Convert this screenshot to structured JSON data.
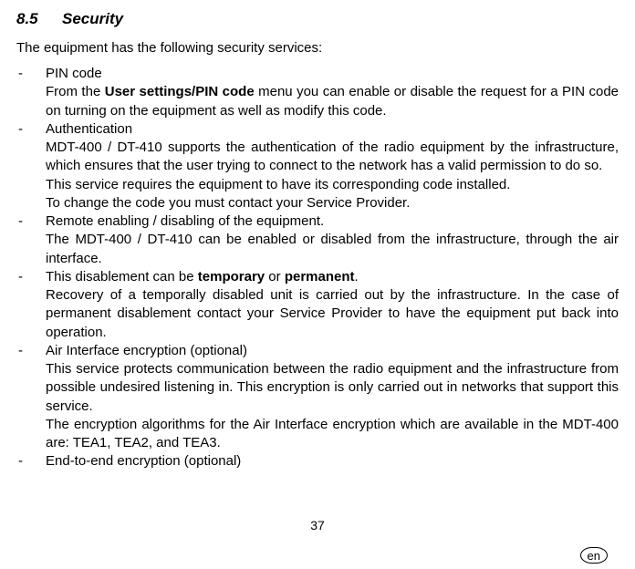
{
  "heading": {
    "number": "8.5",
    "title": "Security"
  },
  "intro": "The equipment has the following security services:",
  "items": [
    {
      "bullet": "PIN code",
      "paras": [
        {
          "pre": "From the ",
          "bold": "User settings/PIN code",
          "post": " menu you can enable or disable the request for a PIN code on turning on the equipment as well as modify this code."
        }
      ]
    },
    {
      "bullet": "Authentication",
      "paras": [
        {
          "pre": "MDT-400 / DT-410 supports the authentication of the radio equipment by the infrastructure, which ensures that the user trying to connect to the network has a valid permission to do so.",
          "bold": "",
          "post": ""
        },
        {
          "pre": "This service requires the equipment to have its corresponding code installed.",
          "bold": "",
          "post": ""
        },
        {
          "pre": "To change the code you must contact your Service Provider.",
          "bold": "",
          "post": ""
        }
      ]
    },
    {
      "bullet": "Remote enabling / disabling of the equipment.",
      "paras": [
        {
          "pre": "The MDT-400 / DT-410 can be enabled or disabled from the infrastructure, through the air interface.",
          "bold": "",
          "post": ""
        }
      ]
    },
    {
      "bullet_pre": "This disablement can be ",
      "bullet_b1": "temporary",
      "bullet_mid": " or ",
      "bullet_b2": "permanent",
      "bullet_post": ".",
      "paras": [
        {
          "pre": "Recovery of a temporally disabled unit is carried out by the infrastructure. In the case of permanent disablement contact your Service Provider to have the equipment put back into operation.",
          "bold": "",
          "post": ""
        }
      ]
    },
    {
      "bullet": " Air Interface encryption (optional)",
      "paras": [
        {
          "pre": "This service protects communication between the radio equipment and the infrastructure from possible undesired listening in. This encryption is only carried out in networks that support this service.",
          "bold": "",
          "post": ""
        },
        {
          "pre": "The encryption algorithms for the Air Interface encryption which are available in the MDT-400 are: TEA1, TEA2, and TEA3.",
          "bold": "",
          "post": ""
        }
      ]
    },
    {
      "bullet": "End-to-end encryption (optional)",
      "paras": []
    }
  ],
  "page_number": "37",
  "lang_badge": "en"
}
